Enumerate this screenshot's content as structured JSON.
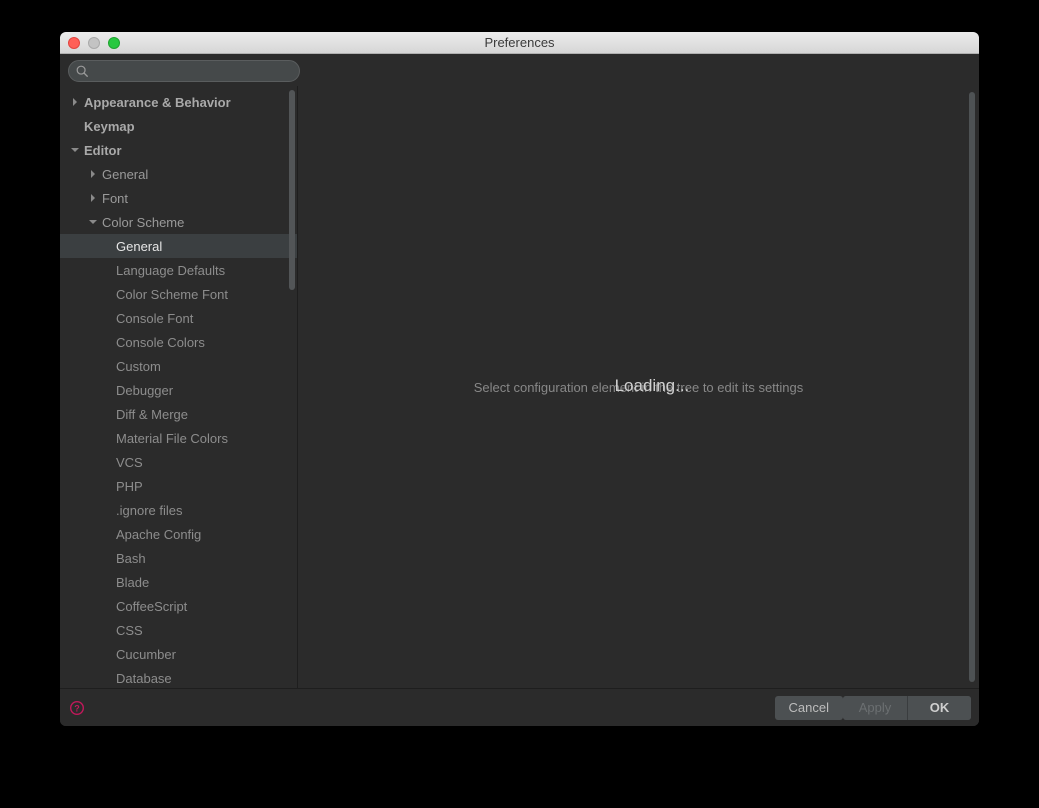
{
  "window": {
    "title": "Preferences"
  },
  "search": {
    "value": ""
  },
  "sidebar": {
    "items": [
      {
        "label": "Appearance & Behavior",
        "level": "top",
        "arrow": "right"
      },
      {
        "label": "Keymap",
        "level": "top",
        "arrow": "none"
      },
      {
        "label": "Editor",
        "level": "top",
        "arrow": "down"
      },
      {
        "label": "General",
        "level": "lvl1",
        "arrow": "right"
      },
      {
        "label": "Font",
        "level": "lvl1",
        "arrow": "right"
      },
      {
        "label": "Color Scheme",
        "level": "lvl1",
        "arrow": "down"
      },
      {
        "label": "General",
        "level": "lvl2",
        "arrow": "none",
        "selected": true
      },
      {
        "label": "Language Defaults",
        "level": "lvl2",
        "arrow": "none"
      },
      {
        "label": "Color Scheme Font",
        "level": "lvl2",
        "arrow": "none"
      },
      {
        "label": "Console Font",
        "level": "lvl2",
        "arrow": "none"
      },
      {
        "label": "Console Colors",
        "level": "lvl2",
        "arrow": "none"
      },
      {
        "label": "Custom",
        "level": "lvl2",
        "arrow": "none"
      },
      {
        "label": "Debugger",
        "level": "lvl2",
        "arrow": "none"
      },
      {
        "label": "Diff & Merge",
        "level": "lvl2",
        "arrow": "none"
      },
      {
        "label": "Material File Colors",
        "level": "lvl2",
        "arrow": "none"
      },
      {
        "label": "VCS",
        "level": "lvl2",
        "arrow": "none"
      },
      {
        "label": "PHP",
        "level": "lvl2",
        "arrow": "none"
      },
      {
        "label": ".ignore files",
        "level": "lvl2",
        "arrow": "none"
      },
      {
        "label": "Apache Config",
        "level": "lvl2",
        "arrow": "none"
      },
      {
        "label": "Bash",
        "level": "lvl2",
        "arrow": "none"
      },
      {
        "label": "Blade",
        "level": "lvl2",
        "arrow": "none"
      },
      {
        "label": "CoffeeScript",
        "level": "lvl2",
        "arrow": "none"
      },
      {
        "label": "CSS",
        "level": "lvl2",
        "arrow": "none"
      },
      {
        "label": "Cucumber",
        "level": "lvl2",
        "arrow": "none"
      },
      {
        "label": "Database",
        "level": "lvl2",
        "arrow": "none"
      }
    ]
  },
  "main": {
    "hint": "Select configuration element in the tree to edit its settings",
    "loading": "Loading..."
  },
  "footer": {
    "cancel": "Cancel",
    "apply": "Apply",
    "ok": "OK"
  }
}
